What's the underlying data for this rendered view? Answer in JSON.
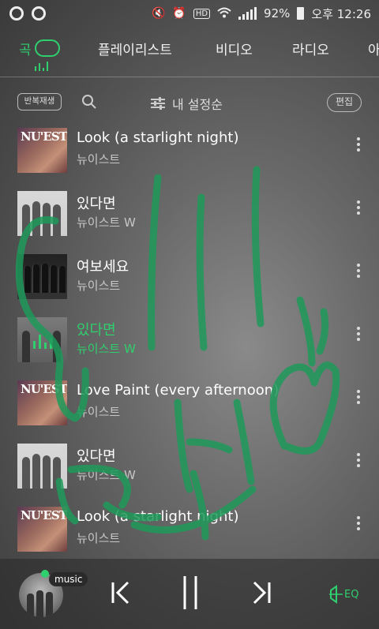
{
  "status_bar": {
    "battery": "92%",
    "time": "오후 12:26",
    "hd": "HD",
    "icons": [
      "app-icon",
      "app-icon",
      "mute-icon",
      "alarm-icon",
      "hd-icon",
      "wifi-icon",
      "signal-icon",
      "battery-icon"
    ]
  },
  "tabs": [
    {
      "label": "곡",
      "active": true
    },
    {
      "label": "플레이리스트",
      "active": false
    },
    {
      "label": "비디오",
      "active": false
    },
    {
      "label": "라디오",
      "active": false
    },
    {
      "label": "아",
      "active": false
    }
  ],
  "toolbar": {
    "repeat_label": "반복재생",
    "sort_label": "내 설정순",
    "edit_label": "편집"
  },
  "songs": [
    {
      "title": "Look (a starlight night)",
      "artist": "뉴이스트",
      "art": "nuest",
      "current": false
    },
    {
      "title": "있다면",
      "artist": "뉴이스트 W",
      "art": "group",
      "current": false
    },
    {
      "title": "여보세요",
      "artist": "뉴이스트",
      "art": "dark",
      "current": false
    },
    {
      "title": "있다면",
      "artist": "뉴이스트 W",
      "art": "playing",
      "current": true
    },
    {
      "title": "Love Paint (every afternoon)",
      "artist": "뉴이스트",
      "art": "nuest",
      "current": false
    },
    {
      "title": "있다면",
      "artist": "뉴이스트 W",
      "art": "group",
      "current": false
    },
    {
      "title": "Look (a starlight night)",
      "artist": "뉴이스트",
      "art": "nuest",
      "current": false
    }
  ],
  "player": {
    "label": "music",
    "eq_label": "EQ",
    "accent": "#2fcf6e"
  }
}
